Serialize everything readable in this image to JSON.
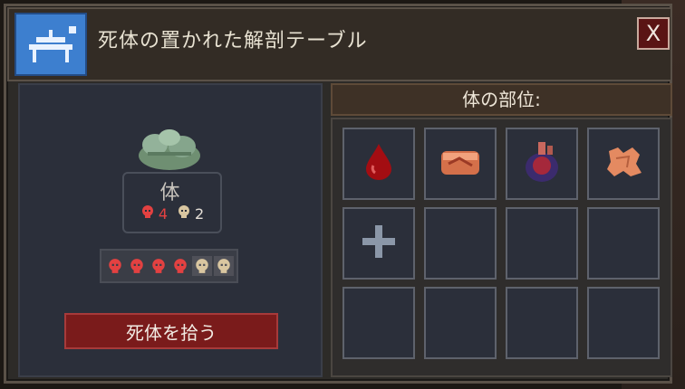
{
  "title": "死体の置かれた解剖テーブル",
  "close_label": "X",
  "body": {
    "label": "体",
    "red_count": "4",
    "pale_count": "2",
    "skull_track": [
      "red",
      "red",
      "red",
      "red",
      "pale",
      "pale"
    ]
  },
  "pickup_button_label": "死体を拾う",
  "parts_header": "体の部位:",
  "slots": [
    {
      "item": "blood-drop-icon"
    },
    {
      "item": "meat-chunk-icon"
    },
    {
      "item": "heart-organ-icon"
    },
    {
      "item": "skin-pelt-icon"
    },
    {
      "item": "plus-icon"
    },
    {
      "item": "empty"
    },
    {
      "item": "empty"
    },
    {
      "item": "empty"
    },
    {
      "item": "empty"
    },
    {
      "item": "empty"
    },
    {
      "item": "empty"
    },
    {
      "item": "empty"
    }
  ],
  "colors": {
    "accent_red": "#7a1b1b",
    "panel_blue": "#2b2f3a",
    "header_brown": "#3e3126"
  }
}
